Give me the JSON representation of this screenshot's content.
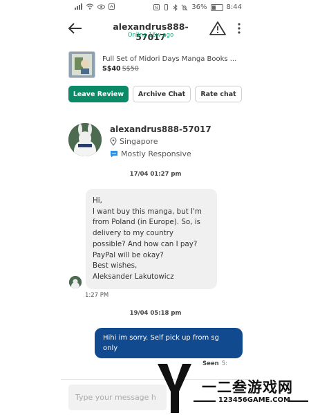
{
  "status_bar": {
    "battery": "36%",
    "time": "8:44"
  },
  "header": {
    "title": "alexandrus888-57017",
    "presence": "Online 16w ago",
    "icons": [
      "back-arrow-icon",
      "warning-triangle-icon",
      "more-vertical-icon"
    ]
  },
  "listing": {
    "title": "Full Set of Midori Days Manga Books ...",
    "price": "S$40",
    "original_price": "S$50"
  },
  "actions": {
    "leave_review": "Leave Review",
    "archive_chat": "Archive Chat",
    "rate_chat": "Rate chat"
  },
  "profile": {
    "name": "alexandrus888-57017",
    "location": "Singapore",
    "responsiveness": "Mostly Responsive"
  },
  "messages": [
    {
      "date": "17/04 01:27 pm",
      "direction": "incoming",
      "lines": [
        "Hi,",
        "I want buy this manga, but I'm",
        "from Poland (in Europe). So, is",
        "delivery to my country",
        "possible? And how can I pay?",
        "PayPal will be okay?",
        "Best wishes,",
        "Aleksander Lakutowicz"
      ],
      "time": "1:27 PM"
    },
    {
      "date": "19/04 05:18 pm",
      "direction": "outgoing",
      "lines": [
        "Hihi im sorry. Self pick up from sg",
        "only"
      ],
      "status": "Seen",
      "time": "5:"
    }
  ],
  "composer": {
    "placeholder": "Type your message h"
  },
  "watermark": {
    "letter": "Y",
    "brand": "一二叁游戏网",
    "url": "123456GAME.COM"
  },
  "colors": {
    "accent_green": "#0a8a67",
    "outgoing_bubble": "#114a8f",
    "incoming_bubble": "#f0f0f1",
    "online": "#1fa57b"
  }
}
